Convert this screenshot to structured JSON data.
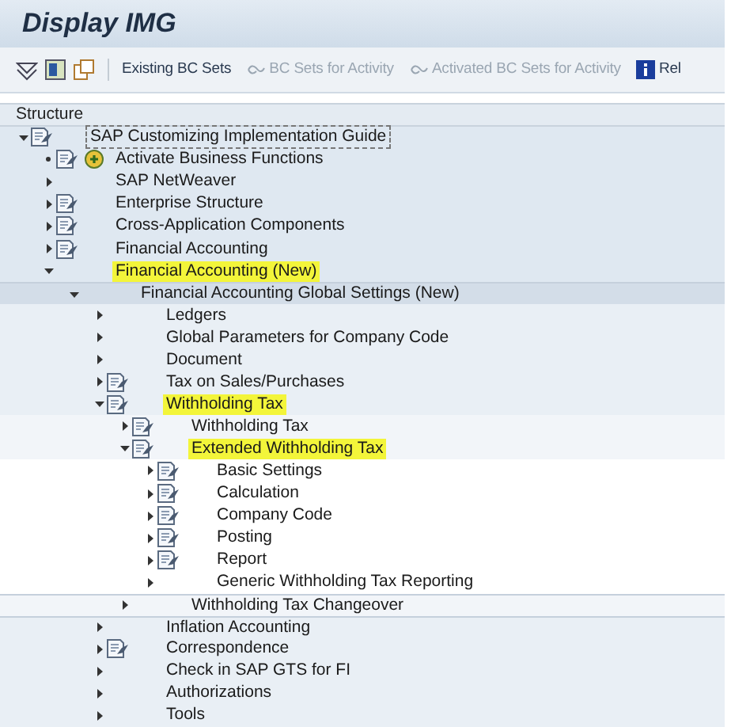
{
  "window": {
    "title": "Display IMG"
  },
  "toolbar": {
    "buttons": [
      {
        "label": "Existing BC Sets",
        "kind": "text",
        "disabled": false
      },
      {
        "label": "BC Sets for Activity",
        "kind": "bc-set",
        "disabled": true
      },
      {
        "label": "Activated BC Sets for Activity",
        "kind": "bc-set",
        "disabled": true
      },
      {
        "label": "Rel",
        "kind": "info",
        "disabled": false
      }
    ]
  },
  "tree": {
    "header": "Structure",
    "items": [
      {
        "label": "SAP Customizing Implementation Guide",
        "doc": true,
        "expanded": true,
        "selected": true,
        "highlighted": false,
        "children": [
          {
            "label": "Activate Business Functions",
            "doc": true,
            "activate": true,
            "selected": false,
            "highlighted": false
          },
          {
            "label": "SAP NetWeaver",
            "doc": false,
            "expanded": false,
            "selected": false,
            "highlighted": false
          },
          {
            "label": "Enterprise Structure",
            "doc": true,
            "expanded": false,
            "selected": false,
            "highlighted": false
          },
          {
            "label": "Cross-Application Components",
            "doc": true,
            "expanded": false,
            "selected": false,
            "highlighted": false
          },
          {
            "label": "Financial Accounting",
            "doc": true,
            "expanded": false,
            "selected": false,
            "highlighted": false
          },
          {
            "label": "Financial Accounting (New)",
            "doc": false,
            "expanded": true,
            "selected": false,
            "highlighted": true,
            "children": [
              {
                "label": "Financial Accounting Global Settings (New)",
                "doc": false,
                "expanded": true,
                "selected": false,
                "highlighted": false,
                "children": [
                  {
                    "label": "Ledgers",
                    "doc": false,
                    "expanded": false,
                    "selected": false,
                    "highlighted": false
                  },
                  {
                    "label": "Global Parameters for Company Code",
                    "doc": false,
                    "expanded": false,
                    "selected": false,
                    "highlighted": false
                  },
                  {
                    "label": "Document",
                    "doc": false,
                    "expanded": false,
                    "selected": false,
                    "highlighted": false
                  },
                  {
                    "label": "Tax on Sales/Purchases",
                    "doc": true,
                    "expanded": false,
                    "selected": false,
                    "highlighted": false
                  },
                  {
                    "label": "Withholding Tax",
                    "doc": true,
                    "expanded": true,
                    "selected": false,
                    "highlighted": true,
                    "children": [
                      {
                        "label": "Withholding Tax",
                        "doc": true,
                        "expanded": false,
                        "selected": false,
                        "highlighted": false
                      },
                      {
                        "label": "Extended Withholding Tax",
                        "doc": true,
                        "expanded": true,
                        "selected": false,
                        "highlighted": true,
                        "children": [
                          {
                            "label": "Basic Settings",
                            "doc": true,
                            "expanded": false,
                            "selected": false,
                            "highlighted": false
                          },
                          {
                            "label": "Calculation",
                            "doc": true,
                            "expanded": false,
                            "selected": false,
                            "highlighted": false
                          },
                          {
                            "label": "Company Code",
                            "doc": true,
                            "expanded": false,
                            "selected": false,
                            "highlighted": false
                          },
                          {
                            "label": "Posting",
                            "doc": true,
                            "expanded": false,
                            "selected": false,
                            "highlighted": false
                          },
                          {
                            "label": "Report",
                            "doc": true,
                            "expanded": false,
                            "selected": false,
                            "highlighted": false
                          },
                          {
                            "label": "Generic Withholding Tax Reporting",
                            "doc": false,
                            "expanded": false,
                            "selected": false,
                            "highlighted": false
                          }
                        ]
                      },
                      {
                        "label": "Withholding Tax Changeover",
                        "doc": false,
                        "expanded": false,
                        "selected": false,
                        "highlighted": false
                      }
                    ]
                  },
                  {
                    "label": "Inflation Accounting",
                    "doc": false,
                    "expanded": false,
                    "selected": false,
                    "highlighted": false
                  },
                  {
                    "label": "Correspondence",
                    "doc": true,
                    "expanded": false,
                    "selected": false,
                    "highlighted": false
                  },
                  {
                    "label": "Check in SAP GTS for FI",
                    "doc": false,
                    "expanded": false,
                    "selected": false,
                    "highlighted": false
                  },
                  {
                    "label": "Authorizations",
                    "doc": false,
                    "expanded": false,
                    "selected": false,
                    "highlighted": false
                  },
                  {
                    "label": "Tools",
                    "doc": false,
                    "expanded": false,
                    "selected": false,
                    "highlighted": false
                  }
                ]
              }
            ]
          }
        ]
      }
    ]
  }
}
